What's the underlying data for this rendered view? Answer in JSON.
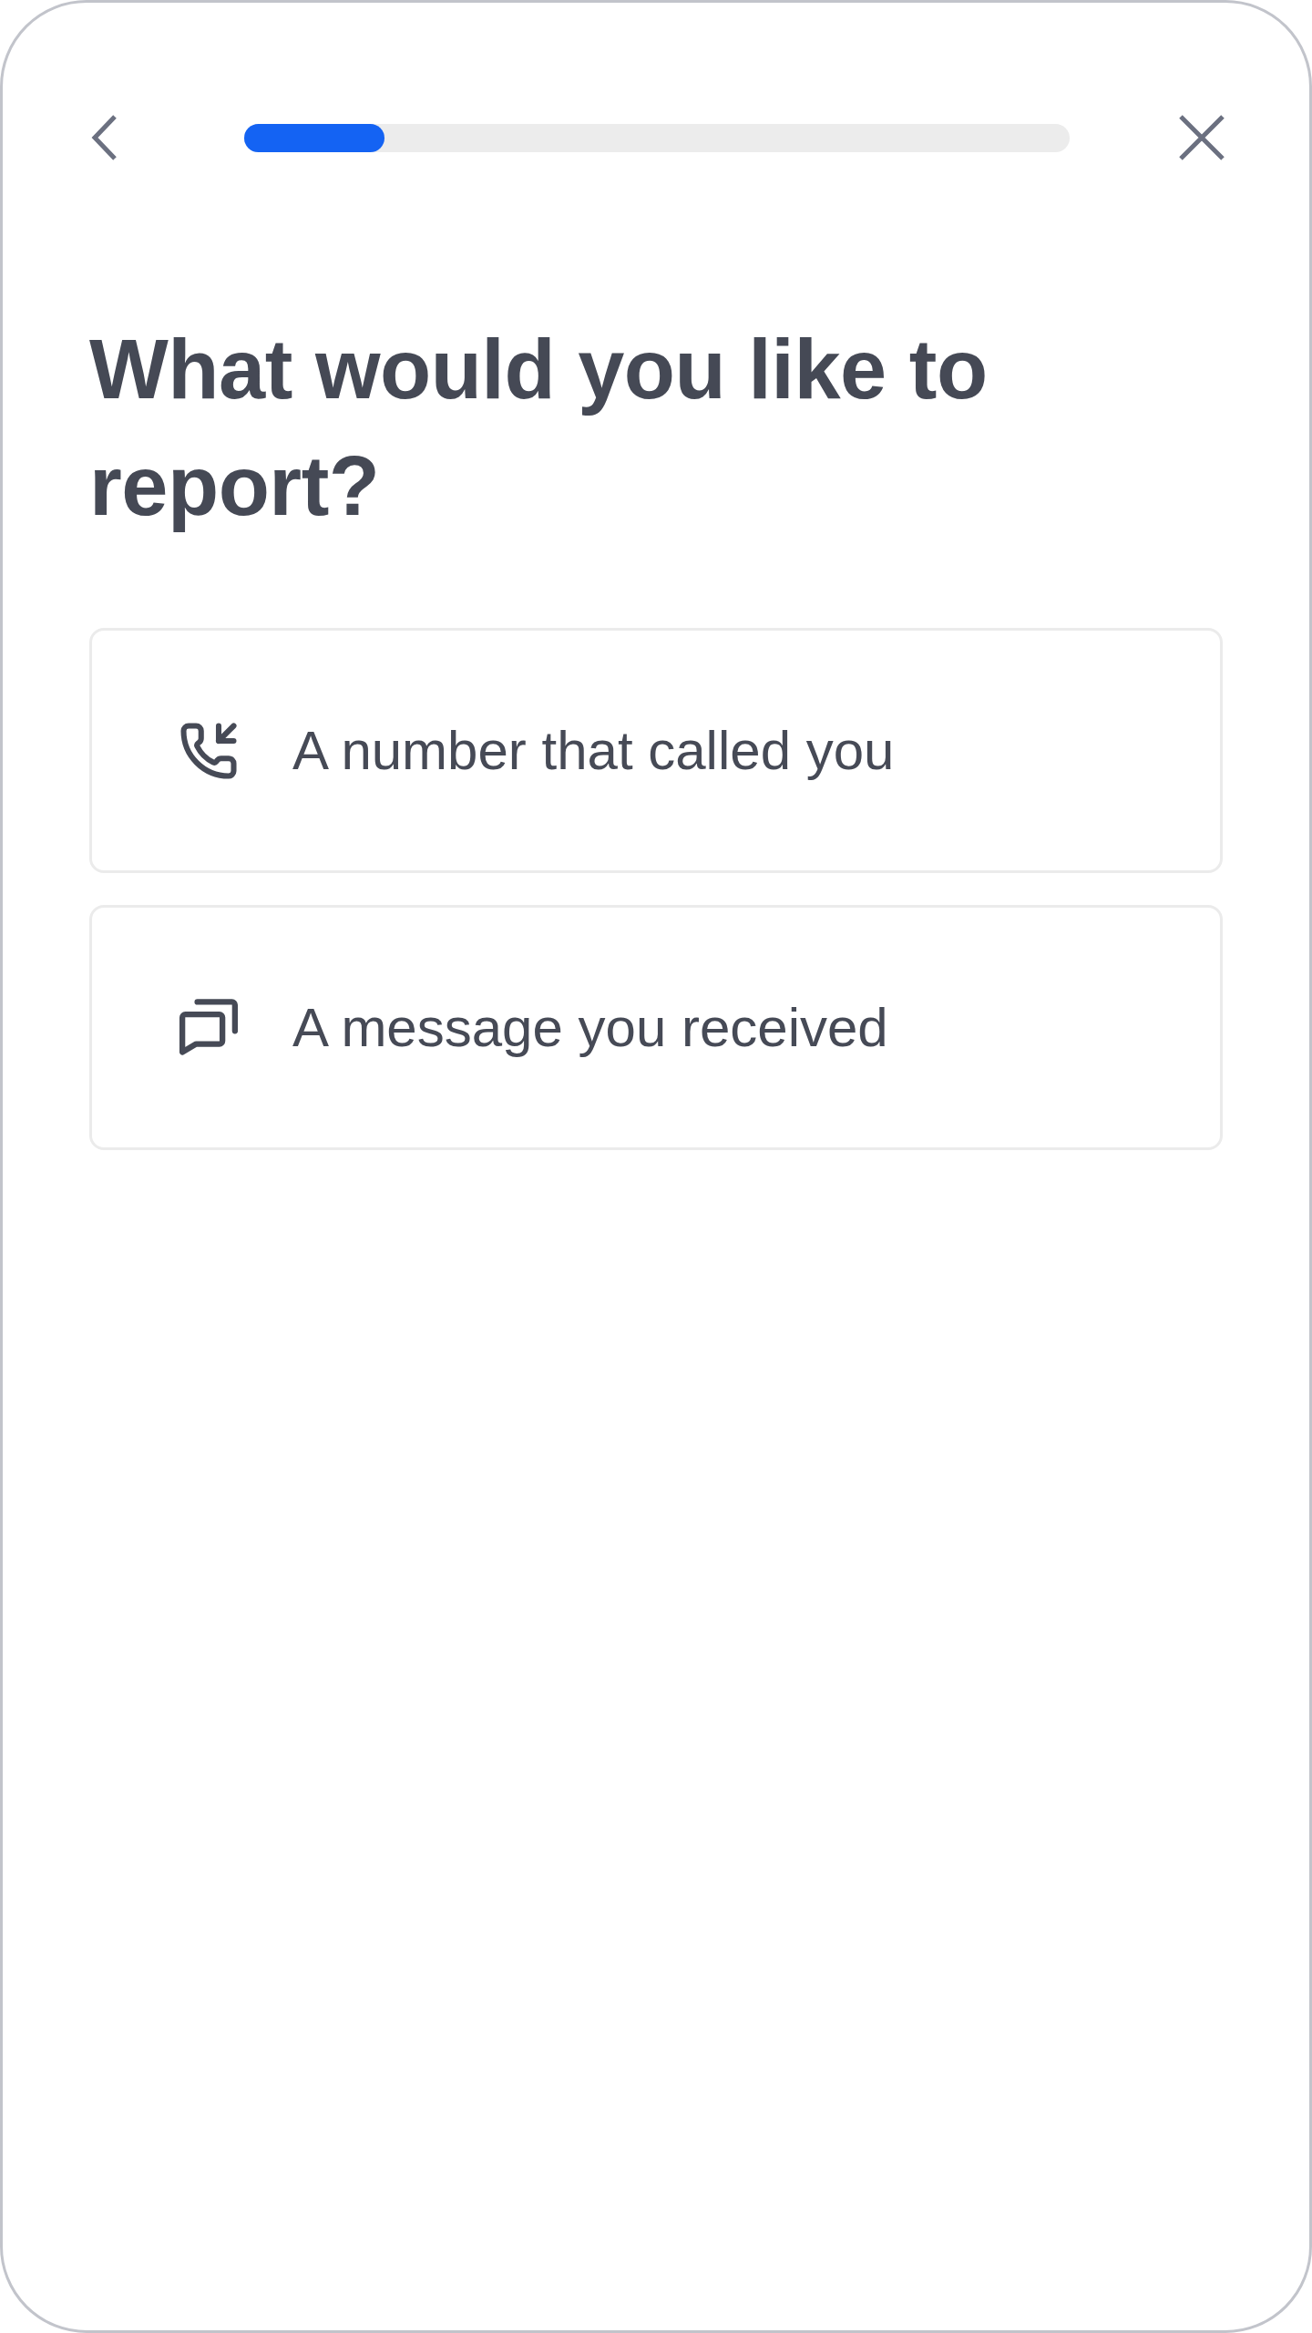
{
  "header": {
    "progress": {
      "level": 0.17
    }
  },
  "title": "What would you like to report?",
  "options": [
    {
      "kind": "incoming-call",
      "label": "A number that called you"
    },
    {
      "kind": "messages",
      "label": "A message you received"
    }
  ]
}
